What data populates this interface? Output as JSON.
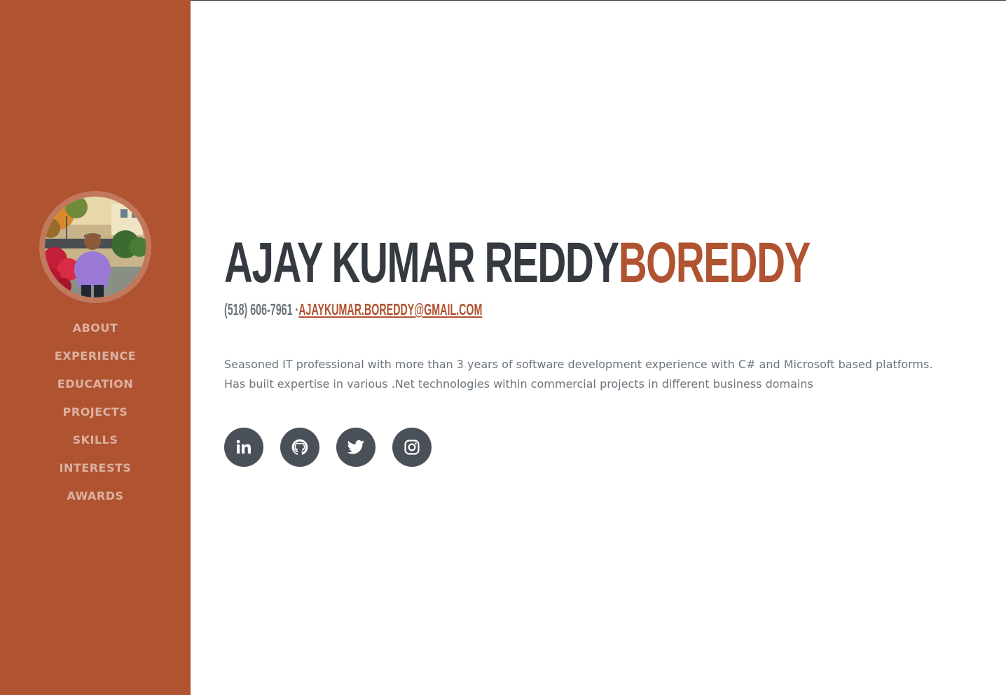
{
  "sidebar": {
    "background": "#b05330",
    "nav": [
      {
        "label": "ABOUT"
      },
      {
        "label": "EXPERIENCE"
      },
      {
        "label": "EDUCATION"
      },
      {
        "label": "PROJECTS"
      },
      {
        "label": "SKILLS"
      },
      {
        "label": "INTERESTS"
      },
      {
        "label": "AWARDS"
      }
    ]
  },
  "about": {
    "first_name": "AJAY KUMAR REDDY",
    "last_name": "BOREDDY",
    "phone": "(518) 606-7961 ·",
    "email": "AJAYKUMAR.BOREDDY@GMAIL.COM",
    "lead_line1": "Seasoned IT professional with more than 3 years of software development experience with C# and Microsoft based platforms.",
    "lead_line2": "Has built expertise in various .Net technologies within commercial projects in different business domains"
  },
  "social": [
    {
      "icon": "linkedin-icon"
    },
    {
      "icon": "github-icon"
    },
    {
      "icon": "twitter-icon"
    },
    {
      "icon": "instagram-icon"
    }
  ],
  "colors": {
    "primary": "#b05330",
    "heading": "#343a40",
    "text": "#6c757d",
    "social_bg": "#495057"
  }
}
